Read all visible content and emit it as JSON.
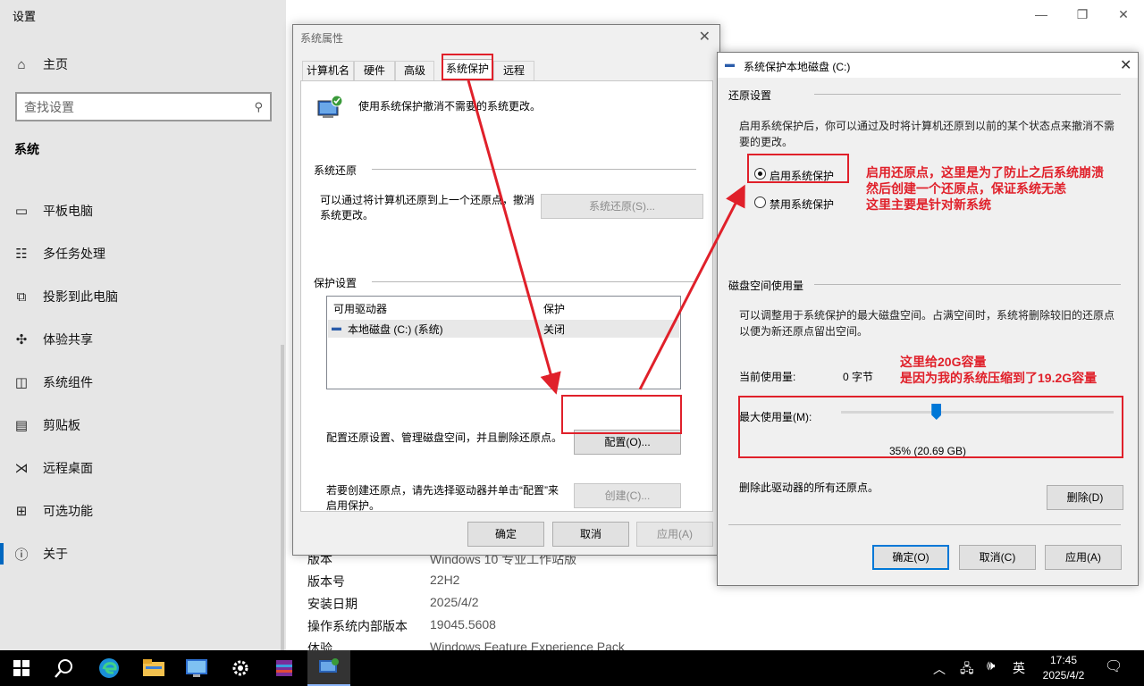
{
  "settings": {
    "title": "设置",
    "home": "主页",
    "search_placeholder": "查找设置",
    "section": "系统",
    "nav": [
      {
        "label": "平板电脑",
        "icon": "tablet-icon"
      },
      {
        "label": "多任务处理",
        "icon": "multitask-icon"
      },
      {
        "label": "投影到此电脑",
        "icon": "project-icon"
      },
      {
        "label": "体验共享",
        "icon": "share-icon"
      },
      {
        "label": "系统组件",
        "icon": "components-icon"
      },
      {
        "label": "剪贴板",
        "icon": "clipboard-icon"
      },
      {
        "label": "远程桌面",
        "icon": "remote-desktop-icon"
      },
      {
        "label": "可选功能",
        "icon": "optional-features-icon"
      },
      {
        "label": "关于",
        "icon": "info-icon"
      }
    ],
    "specs": [
      {
        "k": "版本",
        "v": "Windows 10 专业工作站版"
      },
      {
        "k": "版本号",
        "v": "22H2"
      },
      {
        "k": "安装日期",
        "v": "2025/4/2"
      },
      {
        "k": "操作系统内部版本",
        "v": "19045.5608"
      },
      {
        "k": "体验",
        "v": "Windows Feature Experience Pack"
      }
    ]
  },
  "sysprops": {
    "title": "系统属性",
    "tabs": [
      "计算机名",
      "硬件",
      "高级",
      "系统保护",
      "远程"
    ],
    "intro": "使用系统保护撤消不需要的系统更改。",
    "restore_group": "系统还原",
    "restore_desc_1": "可以通过将计算机还原到上一个还原点，撤消",
    "restore_desc_2": "系统更改。",
    "restore_button": "系统还原(S)...",
    "protect_group": "保护设置",
    "col_drive": "可用驱动器",
    "col_protect": "保护",
    "drive_name": "本地磁盘 (C:) (系统)",
    "drive_status": "关闭",
    "config_desc": "配置还原设置、管理磁盘空间，并且删除还原点。",
    "config_button": "配置(O)...",
    "create_desc_1": "若要创建还原点，请先选择驱动器并单击“配置”来",
    "create_desc_2": "启用保护。",
    "create_button": "创建(C)...",
    "ok": "确定",
    "cancel": "取消",
    "apply": "应用(A)"
  },
  "protect_dialog": {
    "title": "系统保护本地磁盘 (C:)",
    "restore_settings": "还原设置",
    "restore_desc_1": "启用系统保护后，你可以通过及时将计算机还原到以前的某个状态点来撤消不需",
    "restore_desc_2": "要的更改。",
    "option_on": "启用系统保护",
    "option_off": "禁用系统保护",
    "disk_usage": "磁盘空间使用量",
    "usage_desc_1": "可以调整用于系统保护的最大磁盘空间。占满空间时，系统将删除较旧的还原点",
    "usage_desc_2": "以便为新还原点留出空间。",
    "current_label": "当前使用量:",
    "current_value": "0 字节",
    "max_label": "最大使用量(M):",
    "max_value": "35% (20.69 GB)",
    "slider_fraction": 0.35,
    "delete_desc": "删除此驱动器的所有还原点。",
    "delete_button": "删除(D)",
    "ok": "确定(O)",
    "cancel": "取消(C)",
    "apply": "应用(A)"
  },
  "annotations": {
    "a1": "启用还原点，这里是为了防止之后系统崩溃\n然后创建一个还原点，保证系统无恙\n这里主要是针对新系统",
    "a2": "这里给20G容量\n是因为我的系统压缩到了19.2G容量",
    "color": "#e0202a"
  },
  "taskbar": {
    "ime": "英",
    "time": "17:45",
    "date": "2025/4/2"
  }
}
